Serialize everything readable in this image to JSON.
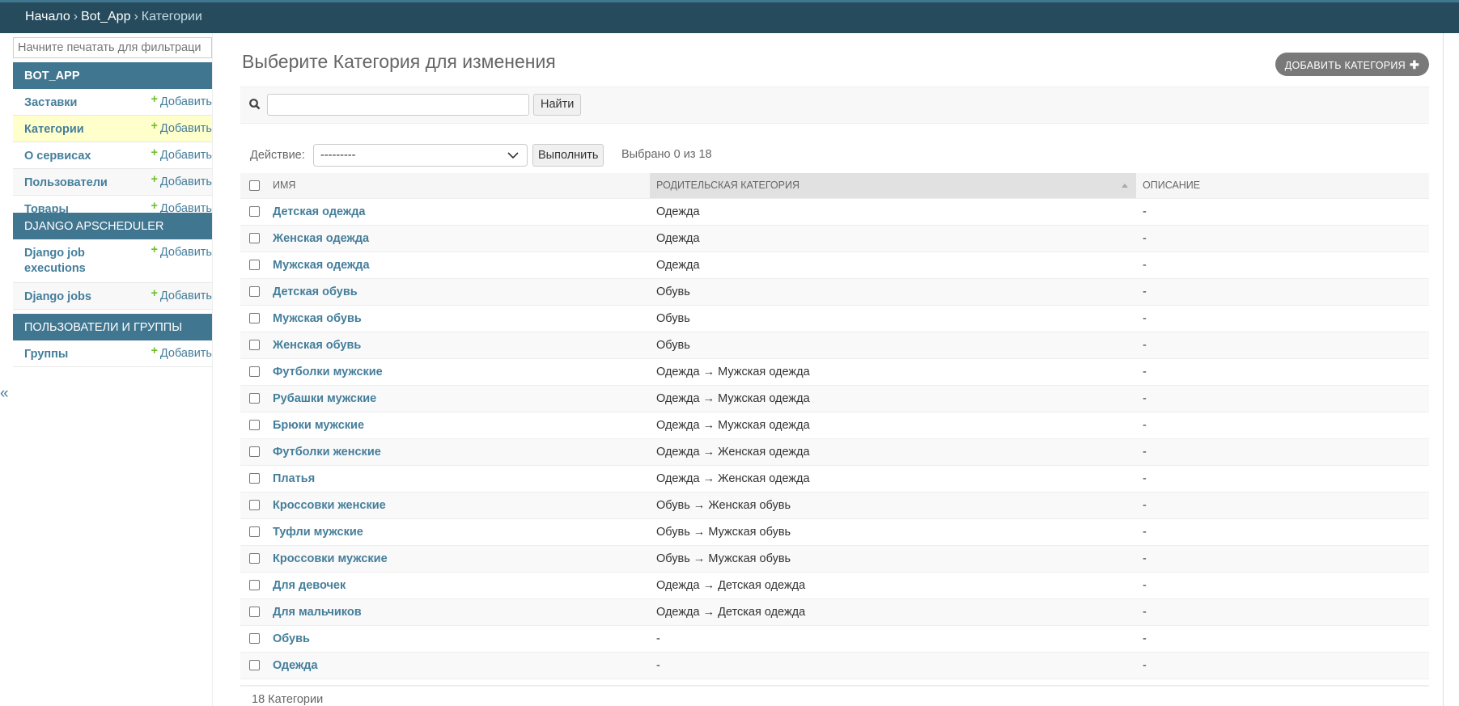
{
  "breadcrumb": {
    "home": "Начало",
    "app": "Bot_App",
    "current": "Категории",
    "sep": "›"
  },
  "sidebar": {
    "filter_placeholder": "Начните печатать для фильтраци",
    "toggle": "«",
    "modules": [
      {
        "title": "BOT_APP",
        "items": [
          {
            "label": "Заставки",
            "add": "Добавить"
          },
          {
            "label": "Категории",
            "add": "Добавить"
          },
          {
            "label": "О сервисах",
            "add": "Добавить"
          },
          {
            "label": "Пользователи",
            "add": "Добавить"
          },
          {
            "label": "Товары",
            "add": "Добавить"
          }
        ]
      },
      {
        "title": "DJANGO APSCHEDULER",
        "items": [
          {
            "label": "Django job executions",
            "add": "Добавить"
          },
          {
            "label": "Django jobs",
            "add": "Добавить"
          }
        ]
      },
      {
        "title": "ПОЛЬЗОВАТЕЛИ И ГРУППЫ",
        "items": [
          {
            "label": "Группы",
            "add": "Добавить"
          }
        ]
      }
    ]
  },
  "main": {
    "title": "Выберите Категория для изменения",
    "add_button": "ДОБАВИТЬ КАТЕГОРИЯ",
    "search": {
      "value": "",
      "button": "Найти"
    },
    "actions": {
      "label": "Действие:",
      "selected": "---------",
      "run": "Выполнить",
      "count": "Выбрано 0 из 18"
    },
    "columns": [
      "Имя",
      "Родительская категория",
      "Описание"
    ],
    "rows": [
      [
        "Детская одежда",
        "Одежда",
        "-"
      ],
      [
        "Женская одежда",
        "Одежда",
        "-"
      ],
      [
        "Мужская одежда",
        "Одежда",
        "-"
      ],
      [
        "Детская обувь",
        "Обувь",
        "-"
      ],
      [
        "Мужская обувь",
        "Обувь",
        "-"
      ],
      [
        "Женская обувь",
        "Обувь",
        "-"
      ],
      [
        "Футболки мужские",
        "Одежда → Мужская одежда",
        "-"
      ],
      [
        "Рубашки мужские",
        "Одежда → Мужская одежда",
        "-"
      ],
      [
        "Брюки мужские",
        "Одежда → Мужская одежда",
        "-"
      ],
      [
        "Футболки женские",
        "Одежда → Женская одежда",
        "-"
      ],
      [
        "Платья",
        "Одежда → Женская одежда",
        "-"
      ],
      [
        "Кроссовки женские",
        "Обувь → Женская обувь",
        "-"
      ],
      [
        "Туфли мужские",
        "Обувь → Мужская обувь",
        "-"
      ],
      [
        "Кроссовки мужские",
        "Обувь → Мужская обувь",
        "-"
      ],
      [
        "Для девочек",
        "Одежда → Детская одежда",
        "-"
      ],
      [
        "Для мальчиков",
        "Одежда → Детская одежда",
        "-"
      ],
      [
        "Обувь",
        "-",
        "-"
      ],
      [
        "Одежда",
        "-",
        "-"
      ]
    ],
    "footer": "18 Категории"
  }
}
